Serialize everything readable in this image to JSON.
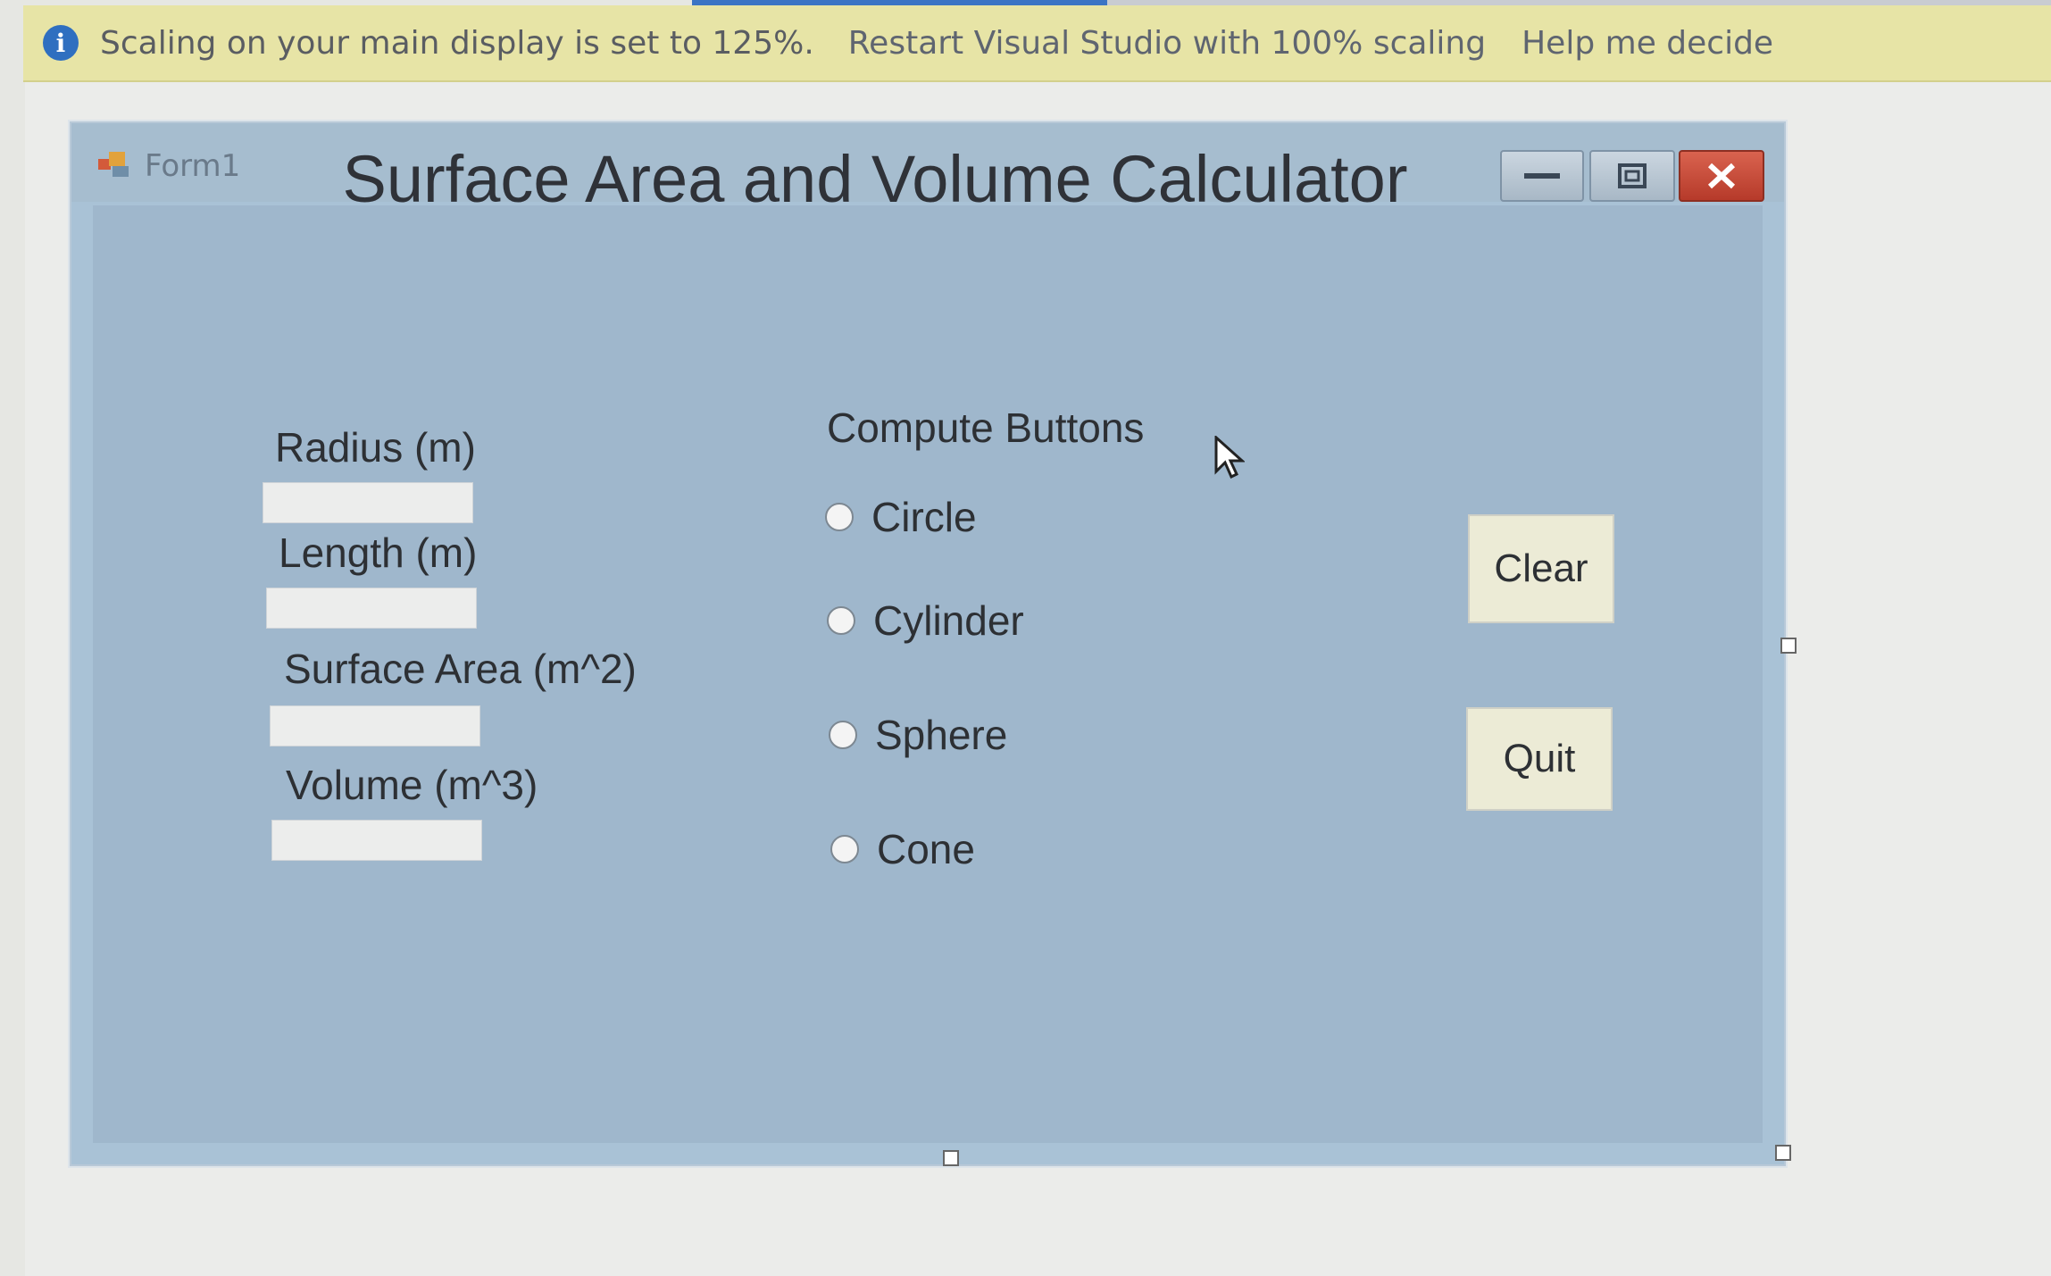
{
  "infobar": {
    "message": "Scaling on your main display is set to 125%.",
    "restart_link": "Restart Visual Studio with 100% scaling",
    "help_link": "Help me decide",
    "icon": "info-icon"
  },
  "form": {
    "window_title": "Form1",
    "title": "Surface Area and Volume Calculator",
    "fields": [
      {
        "label": "Radius (m)",
        "value": ""
      },
      {
        "label": "Length (m)",
        "value": ""
      },
      {
        "label": "Surface Area (m^2)",
        "value": ""
      },
      {
        "label": "Volume (m^3)",
        "value": ""
      }
    ],
    "group_label": "Compute Buttons",
    "radios": [
      "Circle",
      "Cylinder",
      "Sphere",
      "Cone"
    ],
    "clear_label": "Clear",
    "quit_label": "Quit"
  },
  "colors": {
    "infobar": "#e7e4a6",
    "form_background": "#9fb7cc",
    "close_button": "#c2432f"
  }
}
